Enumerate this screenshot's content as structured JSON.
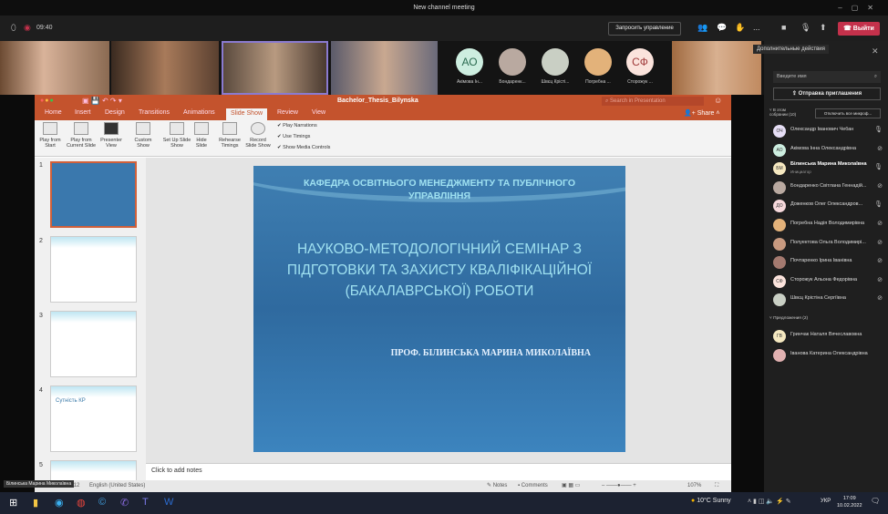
{
  "window": {
    "title": "New channel meeting"
  },
  "toolbar": {
    "timer": "09:40",
    "request_control": "Запросить управление",
    "leave": "Выйти",
    "more": "..."
  },
  "participants_strip": [
    {
      "initials": "АО",
      "name": "Акімова Ін...",
      "color": "#cdeee0"
    },
    {
      "initials": "",
      "name": "Бондаренк...",
      "color": "#b9a9a0"
    },
    {
      "initials": "",
      "name": "Швєц Крісті...",
      "color": "#c9cfc4"
    },
    {
      "initials": "",
      "name": "Погребна ...",
      "color": "#e3b27a"
    },
    {
      "initials": "СФ",
      "name": "Сторожук ...",
      "color": "#fbe3dc"
    }
  ],
  "more_actions_tooltip": "Дополнительные действия",
  "side": {
    "search_placeholder": "Введите имя",
    "invite": "Отправка приглашения",
    "in_meeting": "В этом собрании (10)",
    "mute_all": "Отключить все микроф...",
    "suggested": "Предложения (2)",
    "people": [
      {
        "initials": "ОЧ",
        "name": "Олександр Іванович Чебан",
        "mic": "on",
        "color": "#e6def5"
      },
      {
        "initials": "АО",
        "name": "Акімова Інна Олександрівна",
        "mic": "off",
        "color": "#cdeee0"
      },
      {
        "initials": "БМ",
        "name": "Білинська Марина Миколаївна",
        "role": "Инициатор",
        "mic": "on",
        "color": "#f5e8c0"
      },
      {
        "initials": "",
        "name": "Бондаренко Світлана Геннадій...",
        "mic": "off",
        "color": "#b9a9a0"
      },
      {
        "initials": "ДО",
        "name": "Доженков Олег Олександров...",
        "mic": "on",
        "color": "#f7d9dc"
      },
      {
        "initials": "",
        "name": "Погребна Надія Володимирівна",
        "mic": "off",
        "color": "#e3b27a"
      },
      {
        "initials": "",
        "name": "Полуектова Ольга Володимирі...",
        "mic": "off",
        "color": "#c89a80"
      },
      {
        "initials": "",
        "name": "Почтаренко Ірина Іванівна",
        "mic": "off",
        "color": "#a47a70"
      },
      {
        "initials": "СФ",
        "name": "Сторожук Альона Федорівна",
        "mic": "off",
        "color": "#fbe3dc"
      },
      {
        "initials": "",
        "name": "Швєц Крістіна Сергіївна",
        "mic": "off",
        "color": "#c9cfc4"
      }
    ],
    "suggested_people": [
      {
        "initials": "ГВ",
        "name": "Гринчак Наталя Вячеславовна",
        "color": "#f5e8c0"
      },
      {
        "initials": "",
        "name": "Іванова Катерина Олександрівна",
        "color": "#e0b0b0"
      }
    ]
  },
  "ppt": {
    "doc_title": "Bachelor_Thesis_Bilynska",
    "search_placeholder": "Search in Presentation",
    "share": "Share",
    "tabs": [
      "Home",
      "Insert",
      "Design",
      "Transitions",
      "Animations",
      "Slide Show",
      "Review",
      "View"
    ],
    "active_tab": "Slide Show",
    "ribbon": [
      "Play from Start",
      "Play from Current Slide",
      "Presenter View",
      "Custom Show",
      "Set Up Slide Show",
      "Hide Slide",
      "Rehearse Timings",
      "Record Slide Show"
    ],
    "checks": [
      "Play Narrations",
      "Use Timings",
      "Show Media Controls"
    ],
    "thumb_numbers": [
      "1",
      "2",
      "3",
      "4",
      "5"
    ],
    "thumb4_title": "Сутність КР",
    "slide": {
      "department": "КАФЕДРА ОСВІТНЬОГО МЕНЕДЖМЕНТУ  ТА ПУБЛІЧНОГО УПРАВЛІННЯ",
      "title": "НАУКОВО-МЕТОДОЛОГІЧНИЙ СЕМІНАР З ПІДГОТОВКИ ТА ЗАХИСТУ КВАЛІФІКАЦІЙНОЇ (БАКАЛАВРСЬКОЇ) РОБОТИ",
      "author": "ПРОФ. БІЛИНСЬКА МАРИНА МИКОЛАЇВНА"
    },
    "notes_placeholder": "Click to add notes",
    "status": {
      "slide": "Slide 1 of 12",
      "language": "English (United States)",
      "notes": "Notes",
      "comments": "Comments",
      "zoom": "107%"
    }
  },
  "speaker_label": "Білинська Марина Миколаївна",
  "taskbar": {
    "weather": "10°C  Sunny",
    "lang": "УКР",
    "time": "17:09",
    "date": "10.02.2022",
    "notif": "3"
  }
}
